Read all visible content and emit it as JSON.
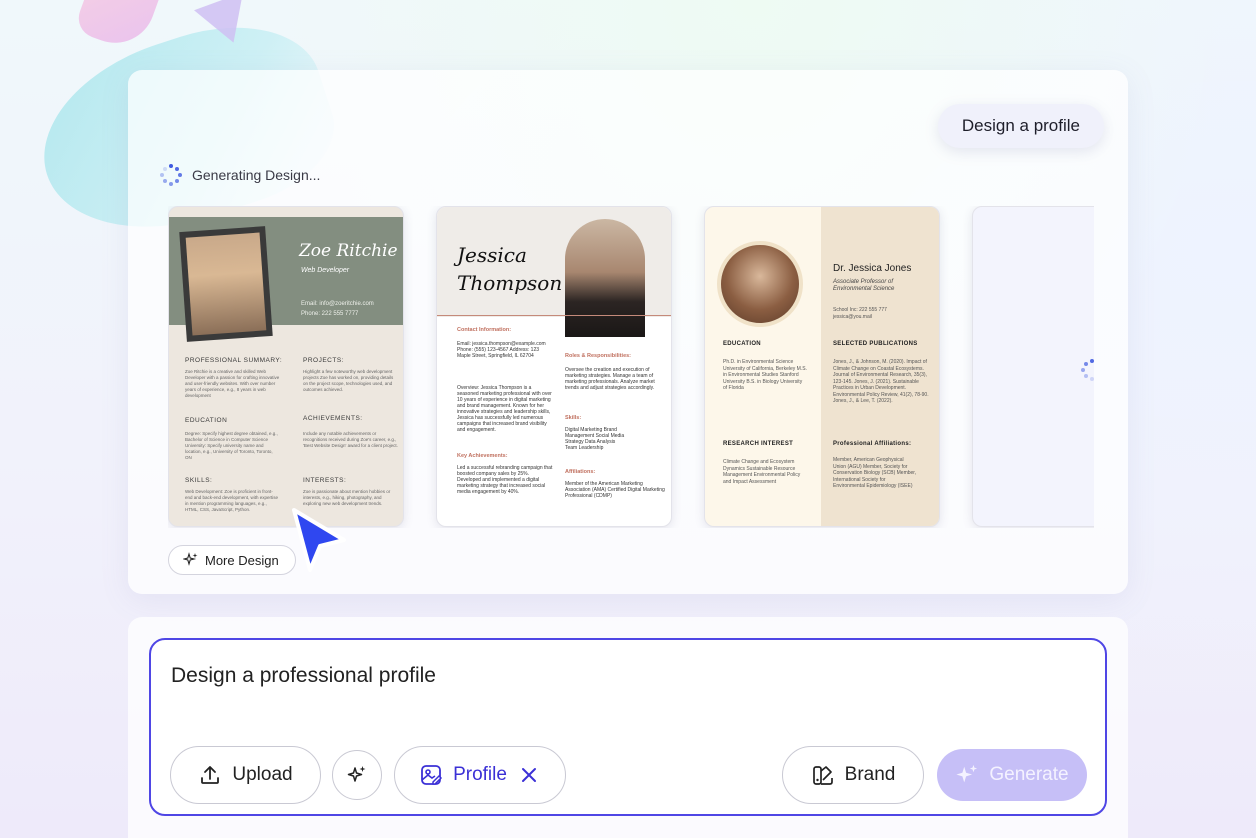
{
  "header": {
    "chip_label": "Design a profile"
  },
  "status": {
    "generating_label": "Generating Design..."
  },
  "cards": {
    "card1": {
      "name": "Zoe Ritchie",
      "role": "Web Developer",
      "contact_email": "Email: info@zoeritchie.com",
      "contact_phone": "Phone: 222 555 7777",
      "sections": {
        "summary_title": "PROFESSIONAL SUMMARY:",
        "summary_text": "Zoe Ritchie is a creative and skilled Web Developer with a passion for crafting innovative and user-friendly websites. With over number years of experience, e.g., 8 years in web development",
        "projects_title": "PROJECTS:",
        "projects_text": "Highlight a few noteworthy web development projects Zoe has worked on, providing details on the project scope, technologies used, and outcomes achieved.",
        "education_title": "EDUCATION",
        "education_text": "Degree: Specify highest degree obtained, e.g., Bachelor of Science in Computer Science University: Specify university name and location, e.g., University of Toronto, Toronto, ON",
        "achievements_title": "ACHIEVEMENTS:",
        "achievements_text": "Include any notable achievements or recognitions received during Zoe's career, e.g., 'Best Website Design' award for a client project.",
        "skills_title": "SKILLS:",
        "skills_text": "Web Development: Zoe is proficient in front-end and back-end development, with expertise in mention programming languages, e.g., HTML, CSS, JavaScript, Python.",
        "interests_title": "INTERESTS:",
        "interests_text": "Zoe is passionate about mention hobbies or interests, e.g., hiking, photography, and exploring new web development trends."
      }
    },
    "card2": {
      "first_name": "Jessica",
      "last_name": "Thompson",
      "contact_title": "Contact Information:",
      "contact_text": "Email: jessica.thompson@example.com Phone: (555) 123-4567 Address: 123 Maple Street, Springfield, IL 62704",
      "overview_text": "Overview: Jessica Thompson is a seasoned marketing professional with over 10 years of experience in digital marketing and brand management. Known for her innovative strategies and leadership skills, Jessica has successfully led numerous campaigns that increased brand visibility and engagement.",
      "achievements_title": "Key Achievements:",
      "achievements_text": "Led a successful rebranding campaign that boosted company sales by 25%. Developed and implemented a digital marketing strategy that increased social media engagement by 40%.",
      "roles_title": "Roles & Responsibilities:",
      "roles_text": "Oversee the creation and execution of marketing strategies. Manage a team of marketing professionals. Analyze market trends and adjust strategies accordingly.",
      "skills_title": "Skills:",
      "skills_text": "Digital Marketing Brand Management Social Media Strategy Data Analysis Team Leadership",
      "affiliations_title": "Affiliations:",
      "affiliations_text": "Member of the American Marketing Association (AMA) Certified Digital Marketing Professional (CDMP)"
    },
    "card3": {
      "name": "Dr. Jessica Jones",
      "title": "Associate Professor of Environmental Science",
      "contact": "School Inc: 222 555 777 jessica@you.mail",
      "education_title": "EDUCATION",
      "education_text": "Ph.D. in Environmental Science University of California, Berkeley M.S. in Environmental Studies Stanford University B.S. in Biology University of Florida",
      "research_title": "RESEARCH INTEREST",
      "research_text": "Climate Change and Ecosystem Dynamics Sustainable Resource Management Environmental Policy and Impact Assessment",
      "publications_title": "SELECTED PUBLICATIONS",
      "publications_text": "Jones, J., & Johnson, M. (2020). Impact of Climate Change on Coastal Ecosystems. Journal of Environmental Research, 35(3), 123-145. Jones, J. (2021). Sustainable Practices in Urban Development. Environmental Policy Review, 41(2), 78-90. Jones, J., & Lee, T. (2022).",
      "affiliations_title": "Professional Affiliations:",
      "affiliations_text": "Member, American Geophysical Union (AGU) Member, Society for Conservation Biology (SCB) Member, International Society for Environmental Epidemiology (ISEE)"
    }
  },
  "more_design": {
    "label": "More Design"
  },
  "prompt": {
    "text": "Design a professional profile",
    "upload_label": "Upload",
    "profile_label": "Profile",
    "brand_label": "Brand",
    "generate_label": "Generate"
  },
  "colors": {
    "accent": "#4f46e5",
    "profile_text": "#3b30d6",
    "generate_bg": "#c6bff7",
    "spinner": "#3f5ae0"
  },
  "icons": [
    "spinner-icon",
    "sparkle-icon",
    "upload-icon",
    "magic-wand-icon",
    "image-edit-icon",
    "close-icon",
    "brand-icon",
    "cursor-arrow-icon"
  ]
}
